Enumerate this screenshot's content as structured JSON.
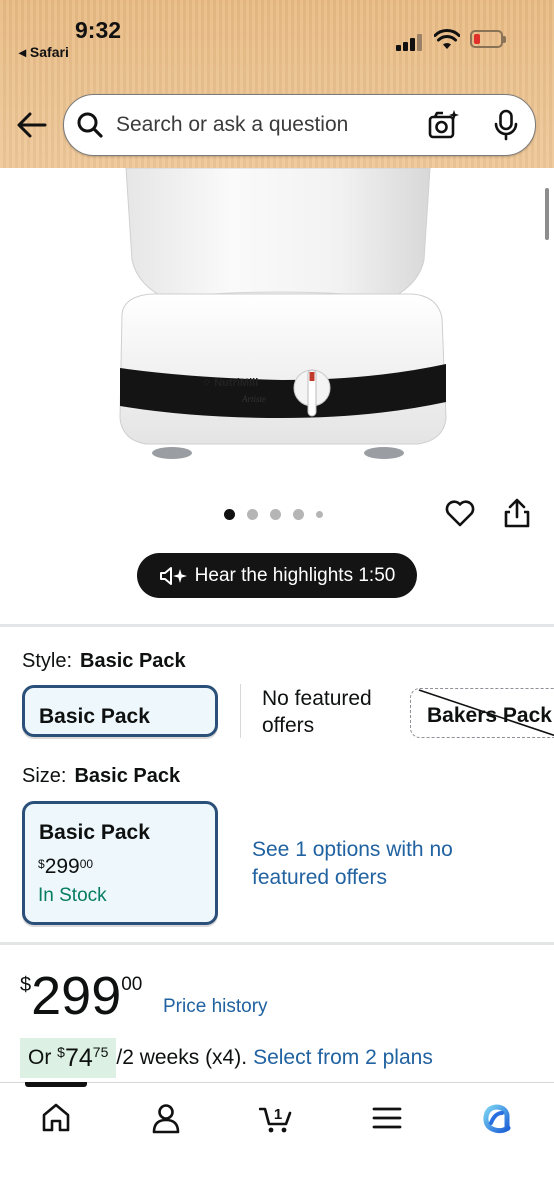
{
  "status_bar": {
    "time": "9:32",
    "back_app": "◂ Safari"
  },
  "search": {
    "placeholder": "Search or ask a question"
  },
  "product_image": {
    "brand": "NutriMill",
    "model": "Artiste",
    "image_index": 1,
    "image_count": 5
  },
  "audio_pill": {
    "label": "Hear the highlights 1:50"
  },
  "style": {
    "label": "Style:",
    "selected": "Basic Pack",
    "options": [
      {
        "label": "Basic Pack",
        "selected": true
      },
      {
        "label": "No featured offers"
      },
      {
        "label": "Bakers Pack",
        "unavailable": true
      }
    ]
  },
  "size": {
    "label": "Size:",
    "selected": "Basic Pack",
    "option": {
      "label": "Basic Pack",
      "price_symbol": "$",
      "price_whole": "299",
      "price_fraction": "00",
      "availability": "In Stock"
    },
    "see_options": "See 1 options with no featured offers"
  },
  "price": {
    "symbol": "$",
    "whole": "299",
    "fraction": "00",
    "price_history": "Price history"
  },
  "installment": {
    "prefix": "Or",
    "symbol": "$",
    "whole": "74",
    "fraction": "75",
    "term": "/2 weeks (x4).",
    "link": "Select from 2 plans"
  },
  "nav": {
    "tabs": [
      "home",
      "account",
      "cart",
      "menu",
      "rufus"
    ],
    "cart_count": "1"
  },
  "colors": {
    "header_bg": "#ecc492",
    "link": "#2162a1",
    "in_stock": "#067d62",
    "selected_border": "#2a4f78",
    "selected_bg": "#edf7fc",
    "installment_bg": "#dcf1e3"
  }
}
